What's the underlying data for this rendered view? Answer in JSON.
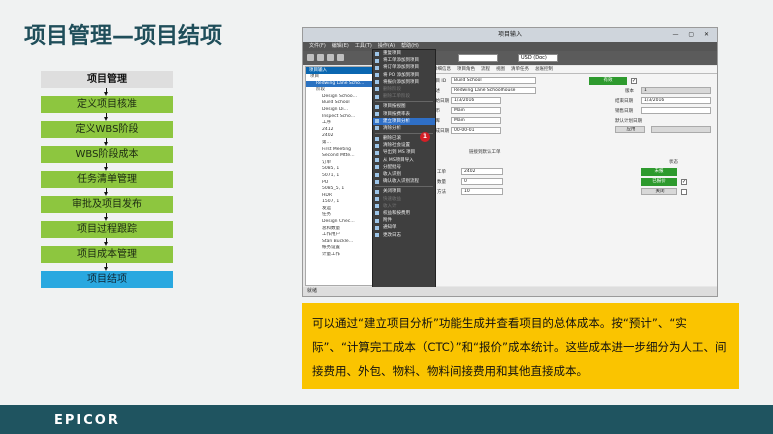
{
  "slide": {
    "title": "项目管理—项目结项"
  },
  "flow": {
    "header": "项目管理",
    "steps": [
      "定义项目核准",
      "定义WBS阶段",
      "WBS阶段成本",
      "任务清单管理",
      "审批及项目发布",
      "项目过程跟踪",
      "项目成本管理",
      "项目结项"
    ],
    "active_index": 7
  },
  "screenshot": {
    "window_title": "项目输入",
    "menus": [
      "文件(F)",
      "编辑(E)",
      "工具(T)",
      "操作(A)",
      "帮助(H)"
    ],
    "currency": "USD (Doc)",
    "tree_title": "项目输入",
    "tree_items": [
      {
        "text": "项目",
        "selected": false
      },
      {
        "text": "Redwing Lane Scho…",
        "selected": true
      },
      {
        "text": "阶段",
        "selected": false
      },
      {
        "text": "Design Schoo…",
        "selected": false
      },
      {
        "text": "Build School",
        "selected": false
      },
      {
        "text": "Design Di…",
        "selected": false
      },
      {
        "text": "Inspect Scho…",
        "selected": false
      },
      {
        "text": "工序",
        "selected": false
      },
      {
        "text": "2412",
        "selected": false
      },
      {
        "text": "2402",
        "selected": false
      },
      {
        "text": "第…",
        "selected": false
      },
      {
        "text": "First Meeting",
        "selected": false
      },
      {
        "text": "Second Mtte…",
        "selected": false
      },
      {
        "text": "订单",
        "selected": false
      },
      {
        "text": "5085, 1",
        "selected": false
      },
      {
        "text": "5071, 1",
        "selected": false
      },
      {
        "text": "PO",
        "selected": false
      },
      {
        "text": "5085_5, 1",
        "selected": false
      },
      {
        "text": "HDR",
        "selected": false
      },
      {
        "text": "1507, 1",
        "selected": false
      },
      {
        "text": "发运",
        "selected": false
      },
      {
        "text": "任务",
        "selected": false
      },
      {
        "text": "Design Chec…",
        "selected": false
      },
      {
        "text": "总和数量",
        "selected": false
      },
      {
        "text": "工作用户",
        "selected": false
      },
      {
        "text": "Stan Buckle…",
        "selected": false
      },
      {
        "text": "帐务设置",
        "selected": false
      },
      {
        "text": "计量工作",
        "selected": false
      }
    ],
    "context_menu": [
      {
        "label": "重复项目",
        "state": "normal"
      },
      {
        "label": "将工单添加到项目",
        "state": "normal"
      },
      {
        "label": "将订单添加到项目",
        "state": "normal"
      },
      {
        "label": "将 PO 添加到项目",
        "state": "normal"
      },
      {
        "label": "将报价添加到项目",
        "state": "normal"
      },
      {
        "label": "删除阶段",
        "state": "dim"
      },
      {
        "label": "删除工单阶段",
        "state": "dim"
      },
      {
        "label": "sep",
        "state": "sep"
      },
      {
        "label": "项目按视图",
        "state": "normal"
      },
      {
        "label": "项目按费率表",
        "state": "normal"
      },
      {
        "label": "建立项目分析",
        "state": "highlight"
      },
      {
        "label": "清除分析",
        "state": "normal"
      },
      {
        "label": "sep",
        "state": "sep"
      },
      {
        "label": "删除已滚",
        "state": "normal"
      },
      {
        "label": "清除社会设置",
        "state": "normal"
      },
      {
        "label": "导出到 MS 项目",
        "state": "normal"
      },
      {
        "label": "从 MS项目导入",
        "state": "normal"
      },
      {
        "label": "分配批号",
        "state": "normal"
      },
      {
        "label": "收入识别",
        "state": "normal"
      },
      {
        "label": "确认收入识别流程",
        "state": "normal"
      },
      {
        "label": "sep",
        "state": "sep"
      },
      {
        "label": "关闭项目",
        "state": "normal"
      },
      {
        "label": "快速收益",
        "state": "dim"
      },
      {
        "label": "收入计",
        "state": "dim"
      },
      {
        "label": "权益和按费用",
        "state": "normal"
      },
      {
        "label": "附件",
        "state": "normal"
      },
      {
        "label": "通知单",
        "state": "normal"
      },
      {
        "label": "更改日志",
        "state": "normal"
      }
    ],
    "badge_number": "1",
    "tabs": [
      "详细信息",
      "项目角色",
      "流程",
      "视图",
      "清单任务",
      "总账控制"
    ],
    "form": {
      "project_id_label": "项目 ID",
      "project_id_value": "Build School",
      "description_label": "描述",
      "description_value": "Redwing Lane Schoolhouse",
      "start_date_label": "开始日期",
      "start_date_value": "1/3/2016",
      "currency_label": "货币",
      "currency_value": "Main",
      "warehouse_label": "仓库",
      "warehouse_value": "Main",
      "completion_label": "完成日期",
      "completion_value": "00-00-01",
      "active_label": "有效",
      "version_label": "版本",
      "version_value": "1",
      "end_date_label": "结束日期",
      "end_date_value": "1/3/2016",
      "sales_date_label": "销售日期",
      "default_label": "默认计划日期",
      "apply_label": "应用",
      "group_label": "链接到默认工单",
      "job_label": "工单",
      "job_value": "2402",
      "quantity_label": "数量",
      "quantity_value": "0",
      "method_label": "方法",
      "method_value": "10",
      "status_label": "状态",
      "status_buttons": [
        "未报",
        "已报价",
        "关闭"
      ]
    },
    "status_bar": "就绪"
  },
  "note": {
    "text": "可以通过“建立项目分析”功能生成并查看项目的总体成本。按“预计”、“实际”、“计算完工成本（CTC）”和“报价”成本统计。这些成本进一步细分为人工、间接费用、外包、物料、物料间接费用和其他直接成本。"
  },
  "footer": {
    "logo": "EPICOR"
  },
  "colors": {
    "flow_green": "#8dc63f",
    "flow_active": "#29a8e0",
    "note_bg": "#fac400",
    "footer_bg": "#1f5460",
    "title": "#1f4e5a"
  }
}
